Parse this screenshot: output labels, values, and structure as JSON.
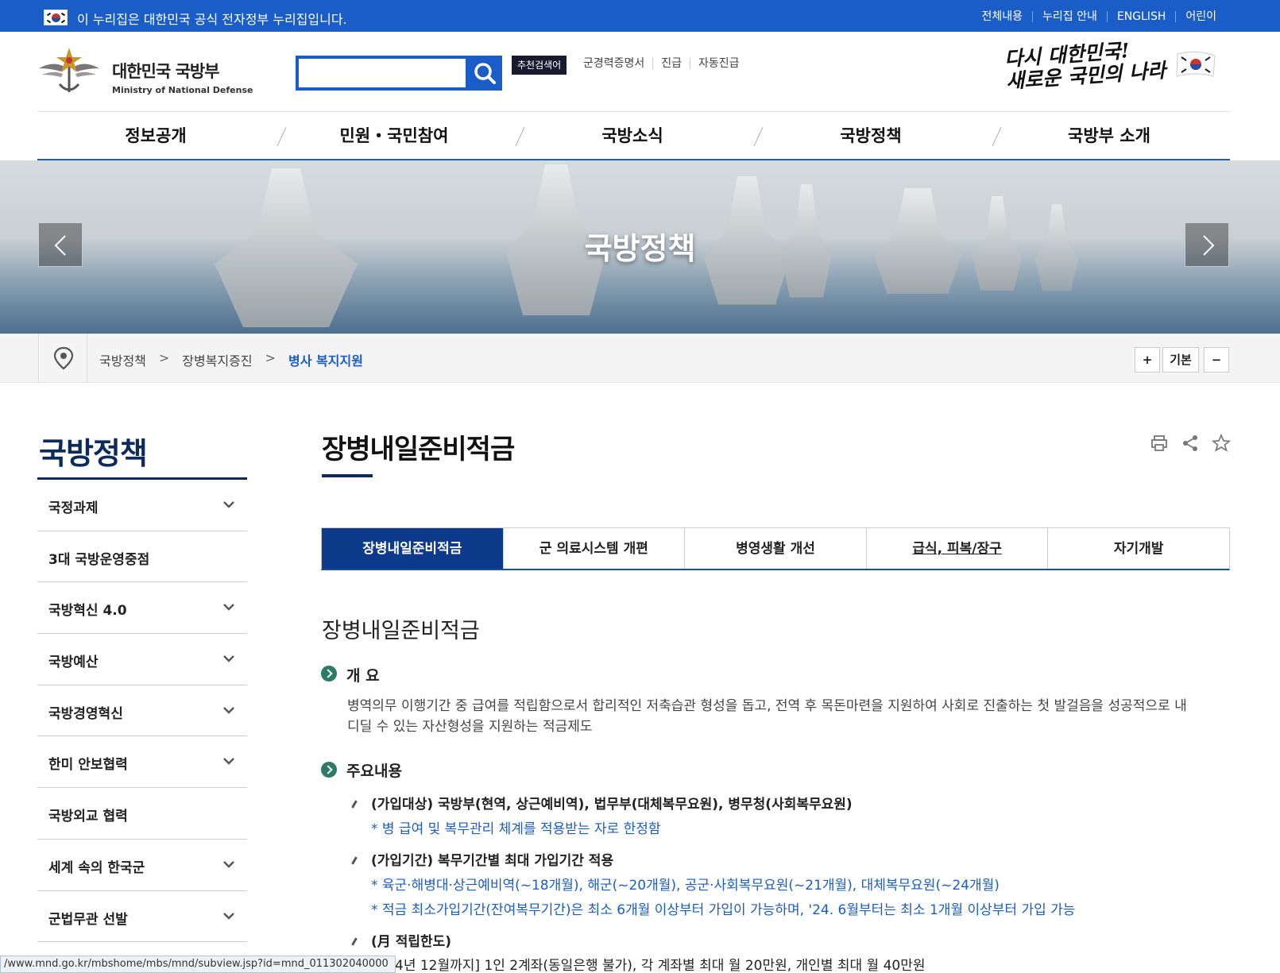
{
  "gov_bar": {
    "text": "이 누리집은 대한민국 공식 전자정부 누리집입니다.",
    "links": [
      "전체내용",
      "누리집 안내",
      "ENGLISH",
      "어린이"
    ]
  },
  "header": {
    "logo_ko": "대한민국 국방부",
    "logo_en": "Ministry of National Defense",
    "search_placeholder": "",
    "recommend_badge": "추천검색어",
    "recommend_links": [
      "군경력증명서",
      "진급",
      "자동진급"
    ],
    "slogan_line1": "다시 대한민국!",
    "slogan_line2": "새로운 국민의 나라"
  },
  "gnb": [
    "정보공개",
    "민원・국민참여",
    "국방소식",
    "국방정책",
    "국방부 소개"
  ],
  "hero": {
    "title": "국방정책"
  },
  "breadcrumb": {
    "items": [
      "국방정책",
      "장병복지증진",
      "병사 복지지원"
    ],
    "zoom_in": "+",
    "zoom_default": "기본",
    "zoom_out": "−"
  },
  "lnb": {
    "title": "국방정책",
    "items": [
      {
        "label": "국정과제",
        "has_children": true
      },
      {
        "label": "3대 국방운영중점",
        "has_children": false
      },
      {
        "label": "국방혁신 4.0",
        "has_children": true
      },
      {
        "label": "국방예산",
        "has_children": true
      },
      {
        "label": "국방경영혁신",
        "has_children": true
      },
      {
        "label": "한미 안보협력",
        "has_children": true
      },
      {
        "label": "국방외교 협력",
        "has_children": false
      },
      {
        "label": "세계 속의 한국군",
        "has_children": true
      },
      {
        "label": "군법무관 선발",
        "has_children": true
      }
    ]
  },
  "content": {
    "page_title": "장병내일준비적금",
    "tabs": [
      "장병내일준비적금",
      "군 의료시스템 개편",
      "병영생활 개선",
      "급식, 피복/장구",
      "자기개발"
    ],
    "active_tab": 0,
    "section_title": "장병내일준비적금",
    "overview_heading": "개 요",
    "overview_text": "병역의무 이행기간 중 급여를 적립함으로서 합리적인 저축습관 형성을 돕고, 전역 후 목돈마련을 지원하여 사회로 진출하는 첫 발걸음을 성공적으로 내디딜 수 있는 자산형성을 지원하는 적금제도",
    "main_heading": "주요내용",
    "item1": "(가입대상) 국방부(현역, 상근예비역), 법무부(대체복무요원), 병무청(사회복무요원)",
    "item1_note": "* 병 급여 및 복무관리 체계를 적용받는 자로 한정함",
    "item2": "(가입기간) 복무기간별 최대 가입기간 적용",
    "item2_note1": "* 육군·해병대·상근예비역(~18개월), 해군(~20개월), 공군·사회복무요원(~21개월), 대체복무요원(~24개월)",
    "item2_note2": "* 적금 최소가입기간(잔여복무기간)은 최소 6개월 이상부터 가입이 가능하며, '24. 6월부터는 최소 1개월 이상부터 가입 가능",
    "item3": "(月 적립한도)",
    "item3_line": "4년 12월까지] 1인 2계좌(동일은행 불가), 각 계좌별 최대 월 20만원, 개인별 최대 월 40만원"
  },
  "status_url": "/www.mnd.go.kr/mbshome/mbs/mnd/subview.jsp?id=mnd_011302040000",
  "colors": {
    "primary": "#1a5dc7",
    "navy": "#0c2a5b",
    "tab_active": "#0e3a8c",
    "bullet": "#2d7b67"
  },
  "icons": [
    "search-icon",
    "location-pin-icon",
    "print-icon",
    "share-icon",
    "star-icon",
    "chevron-down-icon",
    "arrow-left-icon",
    "arrow-right-icon"
  ]
}
